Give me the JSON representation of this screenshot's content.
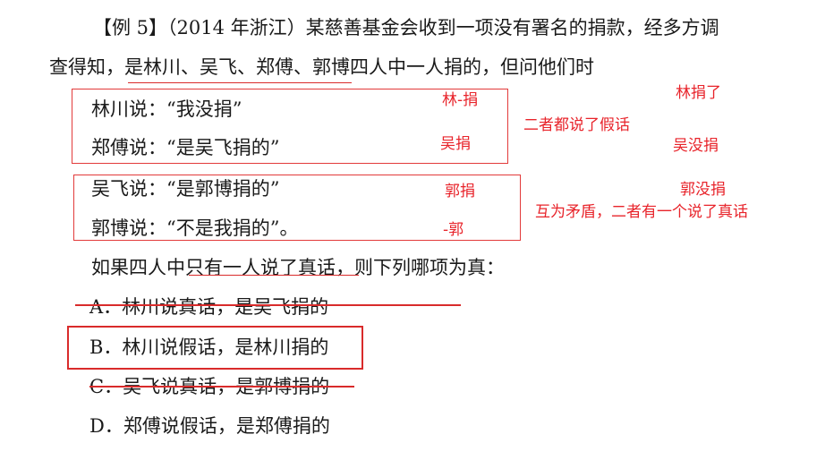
{
  "problem": {
    "line1": "【例 5】（2014 年浙江）某慈善基金会收到一项没有署名的捐款，经多方调",
    "line2_pre": "查得知，",
    "line2_underlined": "是林川、吴飞、郑傅、郭博",
    "line2_post": "四人中一人捐的，但问他们时",
    "statements": [
      "林川说：“我没捐”",
      "郑傅说：“是吴飞捐的”",
      "吴飞说：“是郭博捐的”",
      "郭博说：“不是我捐的”。"
    ],
    "condition_pre": "如果四人中",
    "condition_underlined": "只有一人说了真话",
    "condition_post": "，则下列哪项为真：",
    "options": [
      "A．林川说真话，是吴飞捐的",
      "B．林川说假话，是林川捐的",
      "C．吴飞说真话，是郭博捐的",
      "D．郑傅说假话，是郑傅捐的"
    ]
  },
  "annotations": {
    "lin_juan": "林-捐",
    "wu_juan": "吴捐",
    "both_false": "二者都说了假话",
    "lin_juan_le": "林捐了",
    "wu_mei_juan": "吴没捐",
    "guo_juan": "郭捐",
    "neg_guo": "-郭",
    "guo_mei_juan": "郭没捐",
    "contradiction": "互为矛盾，二者有一个说了真话"
  },
  "colors": {
    "annotation_red": "#e8242b",
    "text": "#1a1a1a",
    "background": "#ffffff"
  }
}
